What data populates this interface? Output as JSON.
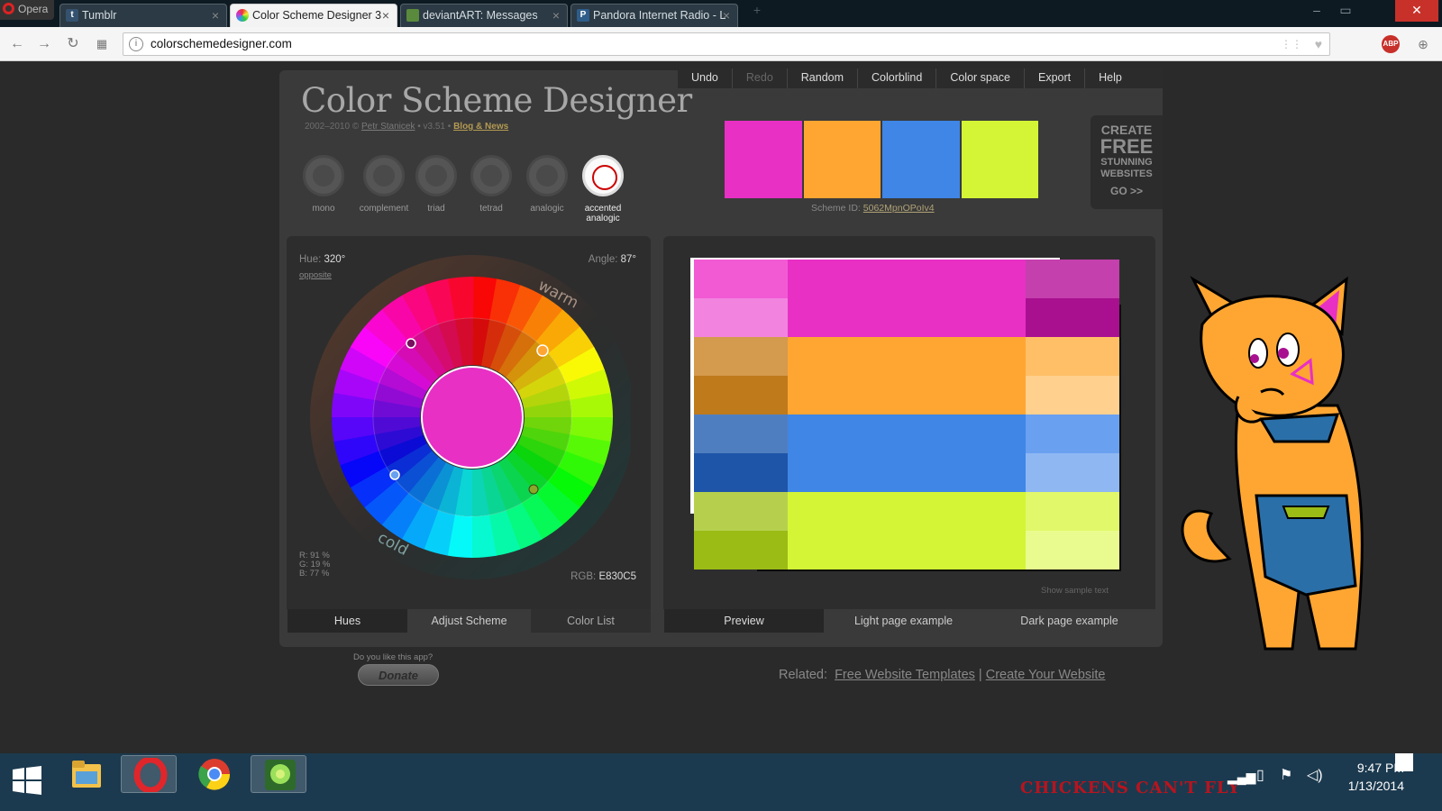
{
  "browser": {
    "opera_label": "Opera",
    "tabs": [
      {
        "title": "Tumblr",
        "favicon": "t",
        "favicon_color": "#34526f",
        "active": false
      },
      {
        "title": "Color Scheme Designer 3",
        "favicon": "",
        "favicon_color": "#e830c5",
        "active": true
      },
      {
        "title": "deviantART: Messages",
        "favicon": "",
        "favicon_color": "#5a8a3c",
        "active": false
      },
      {
        "title": "Pandora Internet Radio - L",
        "favicon": "P",
        "favicon_color": "#2f5d8a",
        "active": false
      }
    ],
    "tab_close": "×",
    "url": "colorschemedesigner.com",
    "adblock_label": "ABP",
    "window_close": "✕"
  },
  "app": {
    "title": "Color Scheme Designer",
    "subtitle_years": "2002–2010 ©",
    "subtitle_author": "Petr Stanicek",
    "subtitle_version": "• v3.51 •",
    "subtitle_blog": "Blog & News",
    "menu": [
      {
        "label": "Undo",
        "enabled": true
      },
      {
        "label": "Redo",
        "enabled": false
      },
      {
        "label": "Random",
        "enabled": true
      },
      {
        "label": "Colorblind",
        "enabled": true
      },
      {
        "label": "Color space",
        "enabled": true
      },
      {
        "label": "Export",
        "enabled": true
      },
      {
        "label": "Help",
        "enabled": true
      }
    ],
    "schemes": [
      {
        "label": "mono",
        "selected": false
      },
      {
        "label": "complement",
        "selected": false
      },
      {
        "label": "triad",
        "selected": false
      },
      {
        "label": "tetrad",
        "selected": false
      },
      {
        "label": "analogic",
        "selected": false
      },
      {
        "label": "accented analogic",
        "selected": true
      }
    ],
    "palette": [
      "#e830c5",
      "#ffa632",
      "#3f86e6",
      "#d3f536"
    ],
    "scheme_id_label": "Scheme ID:",
    "scheme_id": "5062MpnOPoIv4",
    "ad": {
      "line1": "CREATE",
      "line2": "FREE",
      "line3": "STUNNING",
      "line4": "WEBSITES",
      "line5": "GO >>"
    },
    "wheel": {
      "hue_label": "Hue:",
      "hue_value": "320°",
      "opposite_label": "opposite",
      "angle_label": "Angle:",
      "angle_value": "87°",
      "warm_label": "warm",
      "cold_label": "cold",
      "center_color": "#e830c5",
      "r_line": "R: 91 %",
      "g_line": "G: 19 %",
      "b_line": "B: 77 %",
      "rgb_label": "RGB:",
      "rgb_value": "E830C5"
    },
    "left_tabs": [
      {
        "label": "Hues",
        "state": "selected"
      },
      {
        "label": "Adjust Scheme",
        "state": "on"
      },
      {
        "label": "Color List",
        "state": "off"
      }
    ],
    "preview_rows": [
      {
        "left": [
          "#f25ad4",
          "#f284e0"
        ],
        "main": "#e830c5",
        "right": [
          "#c440ad",
          "#a81090"
        ]
      },
      {
        "left": [
          "#d49a4e",
          "#bf7a1c"
        ],
        "main": "#ffa632",
        "right": [
          "#ffbf66",
          "#ffd08e"
        ]
      },
      {
        "left": [
          "#4f7ec0",
          "#1e55a8"
        ],
        "main": "#3f86e6",
        "right": [
          "#6aa0f0",
          "#8fb7f2"
        ]
      },
      {
        "left": [
          "#b6d04e",
          "#9bbb15"
        ],
        "main": "#d3f536",
        "right": [
          "#e0f86a",
          "#e9fb8e"
        ]
      }
    ],
    "show_sample_text": "Show sample text",
    "right_tabs": [
      {
        "label": "Preview",
        "state": "selected"
      },
      {
        "label": "Light page example",
        "state": "on"
      },
      {
        "label": "Dark page example",
        "state": "on"
      }
    ],
    "donate_question": "Do you like this app?",
    "donate_label": "Donate",
    "related_label": "Related:",
    "related_link1": "Free Website Templates",
    "related_sep": "|",
    "related_link2": "Create Your Website"
  },
  "taskbar": {
    "time": "9:47 PM",
    "date": "1/13/2014",
    "wallpaper_text": "CHICKENS CAN'T FLY"
  }
}
